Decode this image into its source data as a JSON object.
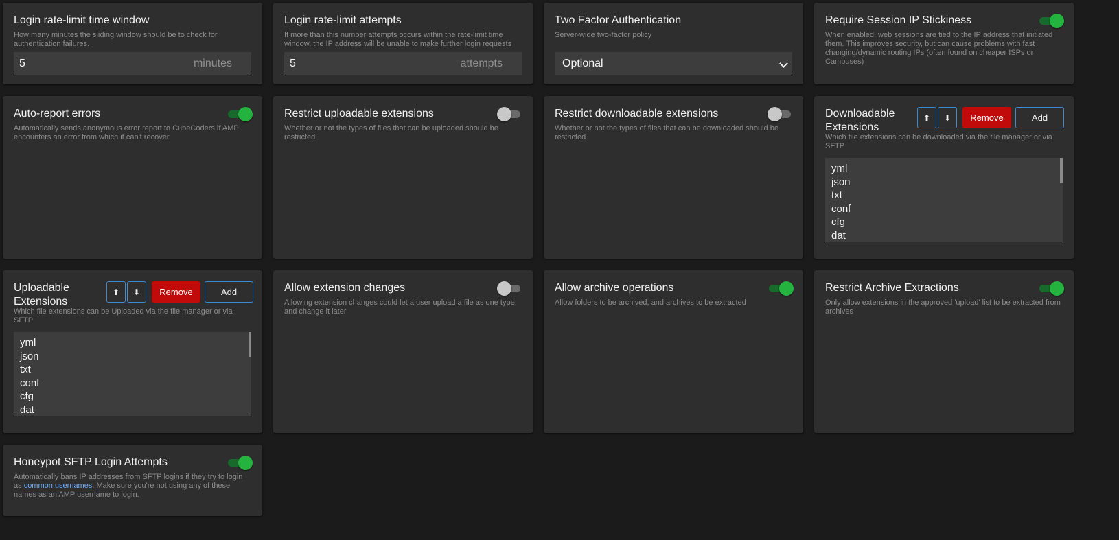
{
  "cards": {
    "rate_window": {
      "title": "Login rate-limit time window",
      "desc": "How many minutes the sliding window should be to check for authentication failures.",
      "value": "5",
      "unit": "minutes"
    },
    "rate_attempts": {
      "title": "Login rate-limit attempts",
      "desc": "If more than this number attempts occurs within the rate-limit time window, the IP address will be unable to make further login requests",
      "value": "5",
      "unit": "attempts"
    },
    "two_factor": {
      "title": "Two Factor Authentication",
      "desc": "Server-wide two-factor policy",
      "selected": "Optional"
    },
    "ip_sticky": {
      "title": "Require Session IP Stickiness",
      "desc": "When enabled, web sessions are tied to the IP address that initiated them. This improves security, but can cause problems with fast changing/dynamic routing IPs (often found on cheaper ISPs or Campuses)",
      "enabled": true
    },
    "auto_report": {
      "title": "Auto-report errors",
      "desc": "Automatically sends anonymous error report to CubeCoders if AMP encounters an error from which it can't recover.",
      "enabled": true
    },
    "restrict_upload": {
      "title": "Restrict uploadable extensions",
      "desc": "Whether or not the types of files that can be uploaded should be restricted",
      "enabled": false
    },
    "restrict_download": {
      "title": "Restrict downloadable extensions",
      "desc": "Whether or not the types of files that can be downloaded should be restricted",
      "enabled": false
    },
    "downloadable_ext": {
      "title": "Downloadable Extensions",
      "desc": "Which file extensions can be downloaded via the file manager or via SFTP",
      "up_icon": "⬆",
      "down_icon": "⬇",
      "remove_label": "Remove",
      "add_label": "Add",
      "items": [
        "yml",
        "json",
        "txt",
        "conf",
        "cfg",
        "dat"
      ]
    },
    "uploadable_ext": {
      "title": "Uploadable Extensions",
      "desc": "Which file extensions can be Uploaded via the file manager or via SFTP",
      "up_icon": "⬆",
      "down_icon": "⬇",
      "remove_label": "Remove",
      "add_label": "Add",
      "items": [
        "yml",
        "json",
        "txt",
        "conf",
        "cfg",
        "dat"
      ]
    },
    "ext_changes": {
      "title": "Allow extension changes",
      "desc": "Allowing extension changes could let a user upload a file as one type, and change it later",
      "enabled": false
    },
    "archive_ops": {
      "title": "Allow archive operations",
      "desc": "Allow folders to be archived, and archives to be extracted",
      "enabled": true
    },
    "restrict_archive": {
      "title": "Restrict Archive Extractions",
      "desc": "Only allow extensions in the approved 'upload' list to be extracted from archives",
      "enabled": true
    },
    "honeypot": {
      "title": "Honeypot SFTP Login Attempts",
      "desc_before": "Automatically bans IP addresses from SFTP logins if they try to login as ",
      "desc_link": "common usernames",
      "desc_after": ". Make sure you're not using any of these names as an AMP username to login.",
      "enabled": true
    }
  },
  "colors": {
    "background": "#1b1b1b",
    "card": "#2e2e2e",
    "toggle_on": "#25b33f",
    "remove_button": "#c10a0a",
    "button_border": "#3a8ad6",
    "link": "#6aa8ff"
  }
}
